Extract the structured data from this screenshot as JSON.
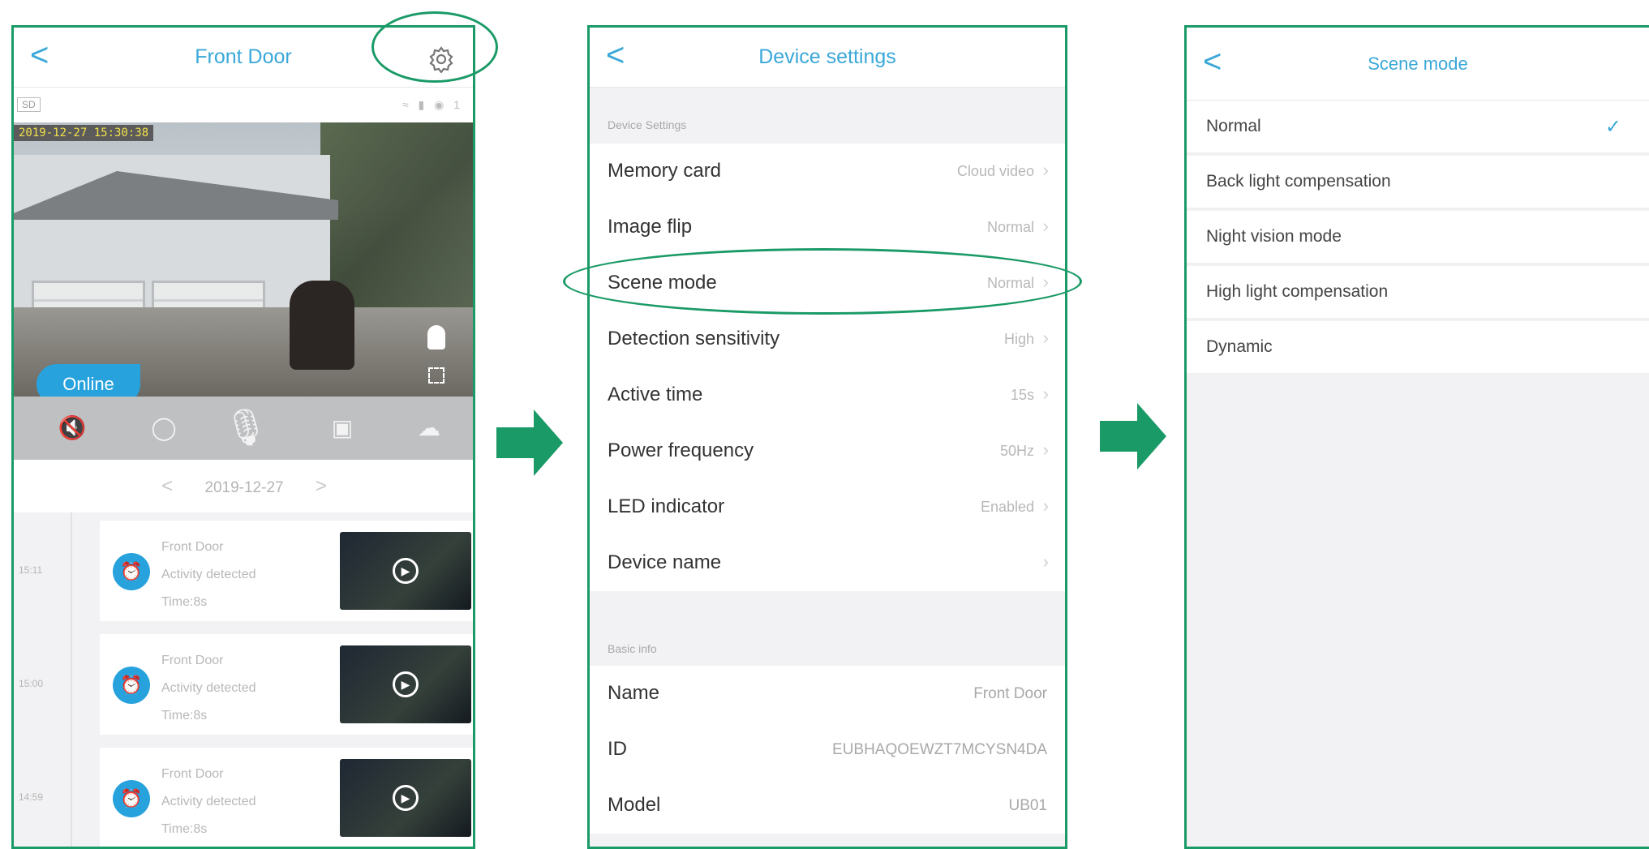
{
  "screen1": {
    "title": "Front Door",
    "back": "<",
    "sd_badge": "SD",
    "timestamp": "2019-12-27  15:30:38",
    "online": "Online",
    "date": "2019-12-27",
    "prev": "<",
    "next": ">",
    "events": [
      {
        "time": "15:11",
        "name": "Front Door",
        "activity": "Activity detected",
        "duration": "Time:8s"
      },
      {
        "time": "15:00",
        "name": "Front Door",
        "activity": "Activity detected",
        "duration": "Time:8s"
      },
      {
        "time": "14:59",
        "name": "Front Door",
        "activity": "Activity detected",
        "duration": "Time:8s"
      }
    ]
  },
  "screen2": {
    "title": "Device settings",
    "back": "<",
    "section_device": "Device Settings",
    "settings": [
      {
        "label": "Memory card",
        "value": "Cloud video"
      },
      {
        "label": "Image flip",
        "value": "Normal"
      },
      {
        "label": "Scene mode",
        "value": "Normal"
      },
      {
        "label": "Detection sensitivity",
        "value": "High"
      },
      {
        "label": "Active time",
        "value": "15s"
      },
      {
        "label": "Power frequency",
        "value": "50Hz"
      },
      {
        "label": "LED indicator",
        "value": "Enabled"
      },
      {
        "label": "Device name",
        "value": ""
      }
    ],
    "section_basic": "Basic info",
    "basic": [
      {
        "label": "Name",
        "value": "Front Door"
      },
      {
        "label": "ID",
        "value": "EUBHAQOEWZT7MCYSN4DA"
      },
      {
        "label": "Model",
        "value": "UB01"
      }
    ]
  },
  "screen3": {
    "title": "Scene mode",
    "back": "<",
    "options": [
      "Normal",
      "Back light compensation",
      "Night vision mode",
      "High light compensation",
      "Dynamic"
    ],
    "selected_index": 0
  },
  "colors": {
    "accent": "#3aa8d8",
    "annotation": "#1a9a66",
    "online": "#27a2dd"
  }
}
